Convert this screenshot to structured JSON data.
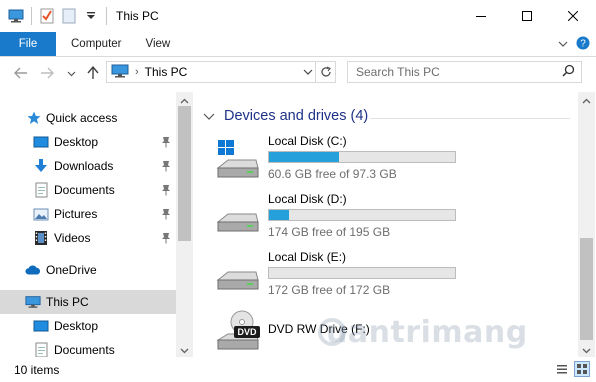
{
  "window": {
    "title": "This PC"
  },
  "ribbon": {
    "tabs": [
      {
        "label": "File"
      },
      {
        "label": "Computer"
      },
      {
        "label": "View"
      }
    ]
  },
  "address_bar": {
    "path": "This PC",
    "separator": "›"
  },
  "search": {
    "placeholder": "Search This PC"
  },
  "nav_pane": {
    "items": [
      {
        "label": "Quick access",
        "icon": "star-icon",
        "pinned": false,
        "selected": false
      },
      {
        "label": "Desktop",
        "icon": "desktop-icon",
        "pinned": true,
        "selected": false
      },
      {
        "label": "Downloads",
        "icon": "download-arrow-icon",
        "pinned": true,
        "selected": false
      },
      {
        "label": "Documents",
        "icon": "document-icon",
        "pinned": true,
        "selected": false
      },
      {
        "label": "Pictures",
        "icon": "pictures-icon",
        "pinned": true,
        "selected": false
      },
      {
        "label": "Videos",
        "icon": "film-icon",
        "pinned": true,
        "selected": false
      },
      {
        "label": "OneDrive",
        "icon": "cloud-icon",
        "pinned": false,
        "selected": false
      },
      {
        "label": "This PC",
        "icon": "computer-icon",
        "pinned": false,
        "selected": true
      },
      {
        "label": "Desktop",
        "icon": "desktop-icon",
        "pinned": false,
        "selected": false
      },
      {
        "label": "Documents",
        "icon": "document-icon",
        "pinned": false,
        "selected": false
      }
    ]
  },
  "content": {
    "group_title": "Devices and drives (4)",
    "drives": [
      {
        "name": "Local Disk (C:)",
        "free_text": "60.6 GB free of 97.3 GB",
        "used_fraction": 0.377,
        "icon": "windows-drive-icon"
      },
      {
        "name": "Local Disk (D:)",
        "free_text": "174 GB free of 195 GB",
        "used_fraction": 0.108,
        "icon": "hard-drive-icon"
      },
      {
        "name": "Local Disk (E:)",
        "free_text": "172 GB free of 172 GB",
        "used_fraction": 0.0,
        "icon": "hard-drive-icon"
      },
      {
        "name": "DVD RW Drive (F:)",
        "free_text": "",
        "used_fraction": null,
        "icon": "dvd-drive-icon",
        "badge": "DVD"
      }
    ]
  },
  "status_bar": {
    "items_text": "10 items"
  },
  "watermark": {
    "text": "uantrimang"
  },
  "colors": {
    "accent": "#1979ca",
    "drive_bar_fill": "#26a0da",
    "group_title": "#1e3287",
    "selection": "#d9d9d9"
  }
}
